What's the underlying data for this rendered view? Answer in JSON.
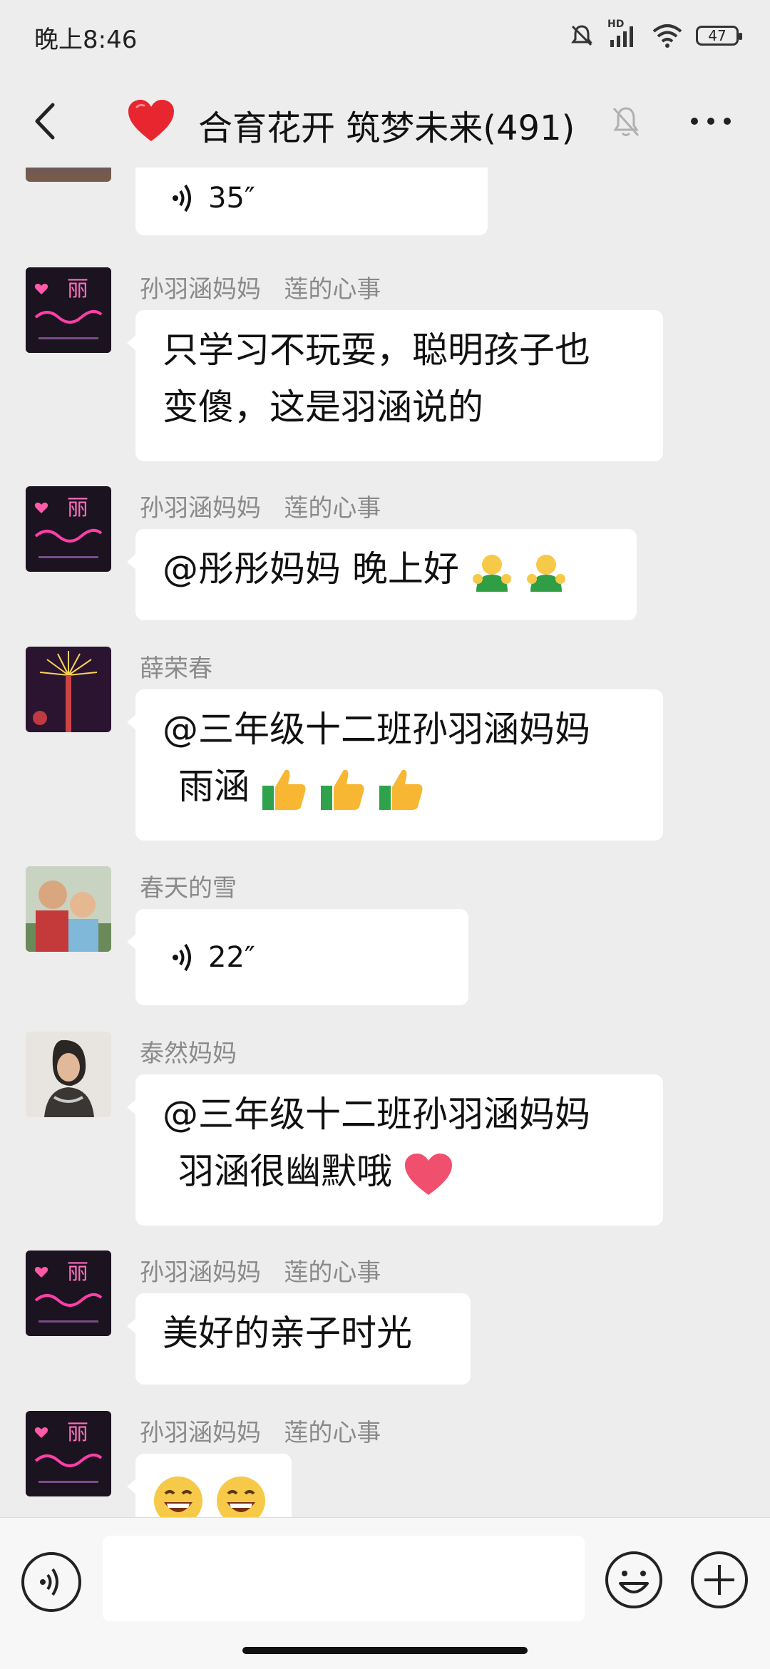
{
  "status_bar": {
    "time": "晚上8:46",
    "battery": "47",
    "network_label": "HD"
  },
  "header": {
    "title": "合育花开 筑梦未来(491)"
  },
  "messages": [
    {
      "type": "voice",
      "duration": "35″"
    },
    {
      "sender": "孙羽涵妈妈   莲的心事",
      "lines": [
        "只学习不玩耍，聪明孩子也",
        "变傻，这是羽涵说的"
      ]
    },
    {
      "sender": "孙羽涵妈妈   莲的心事",
      "text": "@彤彤妈妈  晚上好"
    },
    {
      "sender": "薛荣春",
      "lines": [
        "@三年级十二班孙羽涵妈妈",
        "雨涵"
      ]
    },
    {
      "sender": "春天的雪",
      "type": "voice",
      "duration": "22″"
    },
    {
      "sender": "泰然妈妈",
      "lines": [
        "@三年级十二班孙羽涵妈妈",
        "羽涵很幽默哦"
      ]
    },
    {
      "sender": "孙羽涵妈妈   莲的心事",
      "text": "美好的亲子时光"
    },
    {
      "sender": "孙羽涵妈妈   莲的心事"
    }
  ],
  "avatar_texts": {
    "li": "丽"
  },
  "icons": {
    "back": "chevron-left-icon",
    "heart": "heart-icon",
    "mute": "bell-off-icon",
    "more": "more-dots-icon",
    "voice": "voice-icon",
    "emoji": "smiley-icon",
    "plus": "plus-icon",
    "thumbs_up": "thumbs-up-emoji",
    "hug": "hug-emoji",
    "grin": "grin-emoji"
  },
  "colors": {
    "background": "#ededed",
    "bubble": "#ffffff",
    "sender_name": "#8a8a8a",
    "accent_red": "#e8262f"
  }
}
